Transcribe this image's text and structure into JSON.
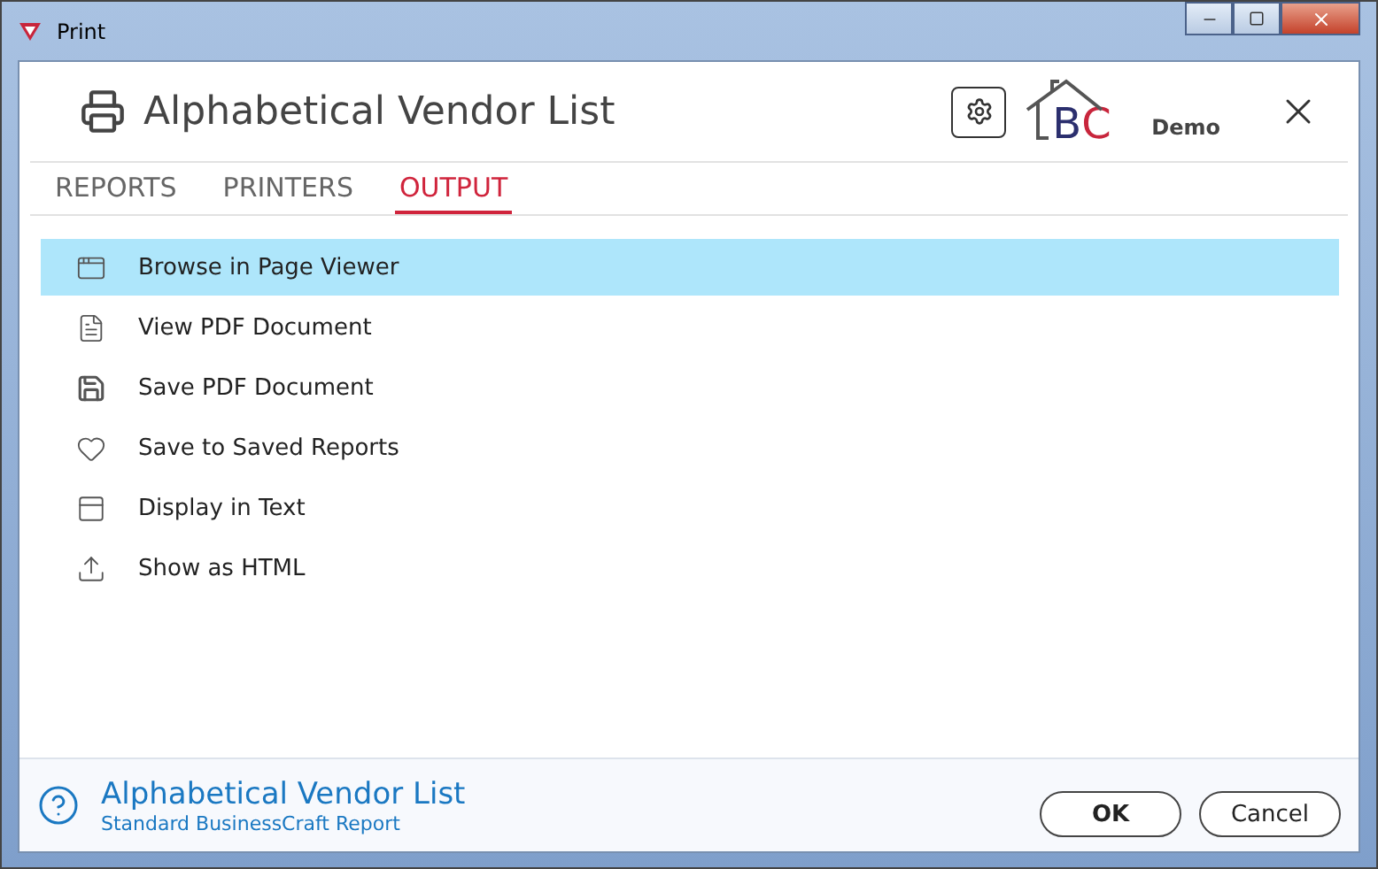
{
  "window": {
    "title": "Print"
  },
  "header": {
    "title": "Alphabetical Vendor List",
    "logo_letters": [
      "B",
      "C"
    ],
    "logo_caption": "Demo"
  },
  "tabs": [
    {
      "label": "REPORTS",
      "selected": false
    },
    {
      "label": "PRINTERS",
      "selected": false
    },
    {
      "label": "OUTPUT",
      "selected": true
    }
  ],
  "options": [
    {
      "label": "Browse in Page Viewer",
      "kind": "window",
      "selected": true
    },
    {
      "label": "View PDF Document",
      "kind": "document",
      "selected": false
    },
    {
      "label": "Save PDF Document",
      "kind": "disk",
      "selected": false
    },
    {
      "label": "Save to Saved Reports",
      "kind": "heart",
      "selected": false
    },
    {
      "label": "Display in Text",
      "kind": "panel",
      "selected": false
    },
    {
      "label": "Show as HTML",
      "kind": "export",
      "selected": false
    }
  ],
  "footer": {
    "title": "Alphabetical Vendor List",
    "subtitle": "Standard BusinessCraft Report",
    "buttons": [
      "OK",
      "Cancel"
    ]
  }
}
